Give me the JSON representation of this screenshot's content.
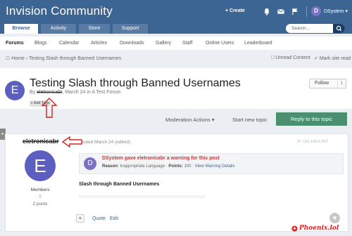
{
  "header": {
    "site_title": "Invision Community",
    "create_label": "+ Create",
    "user_initial": "D",
    "user_name": "DSystem",
    "icons": [
      "bell-icon",
      "envelope-icon",
      "flag-icon"
    ]
  },
  "tabs": [
    {
      "label": "Browse",
      "active": true
    },
    {
      "label": "Activity",
      "active": false
    },
    {
      "label": "Store",
      "active": false
    },
    {
      "label": "Support",
      "active": false
    }
  ],
  "search": {
    "placeholder": "Search..."
  },
  "subnav": [
    "Forums",
    "Blogs",
    "Calendar",
    "Articles",
    "Downloads",
    "Gallery",
    "Staff",
    "Online Users",
    "Leaderboard"
  ],
  "breadcrumb": {
    "home": "Home",
    "topic": "Testing Slash through Banned Usernames"
  },
  "breadcrumb_actions": {
    "unread": "Unread Content",
    "mark_read": "Mark site read"
  },
  "topic": {
    "avatar_initial": "E",
    "title": "Testing Slash through Banned Usernames",
    "by": "By",
    "author": "eletronicabr",
    "date_forum": ", March 24 in A Test Forum",
    "add_tags": "+ Add Tags",
    "follow_label": "Follow",
    "follow_count": "1"
  },
  "actions": {
    "moderation": "Moderation Actions ▾",
    "new_topic": "Start new topic",
    "reply": "Reply to this topic"
  },
  "post": {
    "author": "eletronicabr",
    "date": "Posted March 24 (edited)",
    "ip": "IP: 192.168.0.263",
    "avatar_initial": "E",
    "group": "Members",
    "reputation": "0",
    "post_count": "2 posts",
    "warning": {
      "avatar_initial": "D",
      "title": "DSystem gave eletronicabr a warning for this post",
      "reason_label": "Reason:",
      "reason": "Inappropriate Language",
      "points_label": "Points:",
      "points": "100",
      "link": "View Warning Details"
    },
    "body": "Slash through Banned Usernames",
    "multiquote": "+",
    "quote": "Quote",
    "edit": "Edit"
  },
  "watermark": "Phoenix.lol",
  "colors": {
    "header": "#3d6594",
    "reply": "#4a8f6f",
    "warning_text": "#c23b3b",
    "annotation_arrow": "#d22222"
  }
}
